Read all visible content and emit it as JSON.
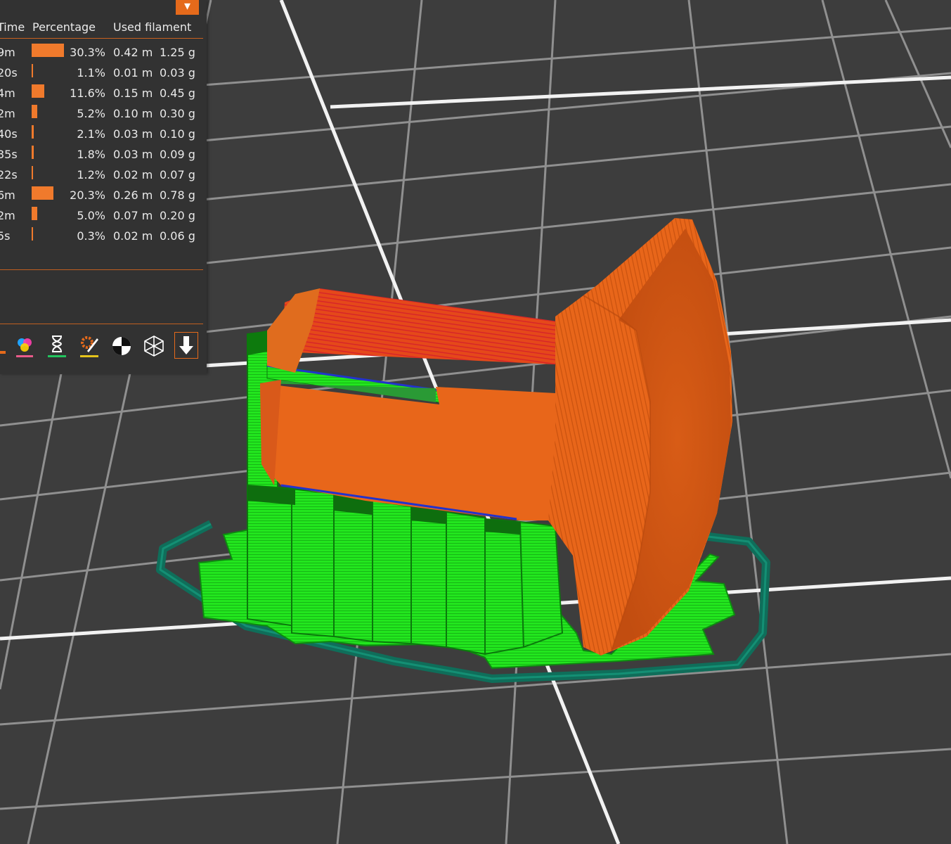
{
  "legend": {
    "collapse_icon": "chevron-down-icon",
    "columns": {
      "time": "Time",
      "percentage": "Percentage",
      "used_filament": "Used filament"
    },
    "rows": [
      {
        "time": "9m",
        "percentage_label": "30.3%",
        "percentage": 30.3,
        "length": "0.42 m",
        "weight": "1.25 g"
      },
      {
        "time": "20s",
        "percentage_label": "1.1%",
        "percentage": 1.1,
        "length": "0.01 m",
        "weight": "0.03 g"
      },
      {
        "time": "4m",
        "percentage_label": "11.6%",
        "percentage": 11.6,
        "length": "0.15 m",
        "weight": "0.45 g"
      },
      {
        "time": "2m",
        "percentage_label": "5.2%",
        "percentage": 5.2,
        "length": "0.10 m",
        "weight": "0.30 g"
      },
      {
        "time": "40s",
        "percentage_label": "2.1%",
        "percentage": 2.1,
        "length": "0.03 m",
        "weight": "0.10 g"
      },
      {
        "time": "35s",
        "percentage_label": "1.8%",
        "percentage": 1.8,
        "length": "0.03 m",
        "weight": "0.09 g"
      },
      {
        "time": "22s",
        "percentage_label": "1.2%",
        "percentage": 1.2,
        "length": "0.02 m",
        "weight": "0.07 g"
      },
      {
        "time": "6m",
        "percentage_label": "20.3%",
        "percentage": 20.3,
        "length": "0.26 m",
        "weight": "0.78 g"
      },
      {
        "time": "2m",
        "percentage_label": "5.0%",
        "percentage": 5.0,
        "length": "0.07 m",
        "weight": "0.20 g"
      },
      {
        "time": "5s",
        "percentage_label": "0.3%",
        "percentage": 0.3,
        "length": "0.02 m",
        "weight": "0.06 g"
      }
    ]
  },
  "toolbar": {
    "items": [
      {
        "name": "color-print-icon",
        "accent": "#e56a1b"
      },
      {
        "name": "color-mix-icon",
        "accent": "#e95a8a"
      },
      {
        "name": "hourglass-icon",
        "accent": "#22c55e"
      },
      {
        "name": "settings-pencil-icon",
        "accent": "#e5c41b"
      },
      {
        "name": "center-of-gravity-icon",
        "accent": "#ffffff"
      },
      {
        "name": "wireframe-cube-icon",
        "accent": "#ffffff"
      },
      {
        "name": "download-arrow-icon",
        "accent": "#e56a1b",
        "active": true
      }
    ]
  },
  "colors": {
    "accent": "#e56a1b",
    "bar": "#f07a2c",
    "panel_bg": "#323232",
    "model_orange": "#e8661a",
    "support_green": "#1ee81e",
    "skirt_teal": "#0f6e5a",
    "bed_grid": "#ffffff",
    "bed_bg": "#3d3d3d"
  }
}
